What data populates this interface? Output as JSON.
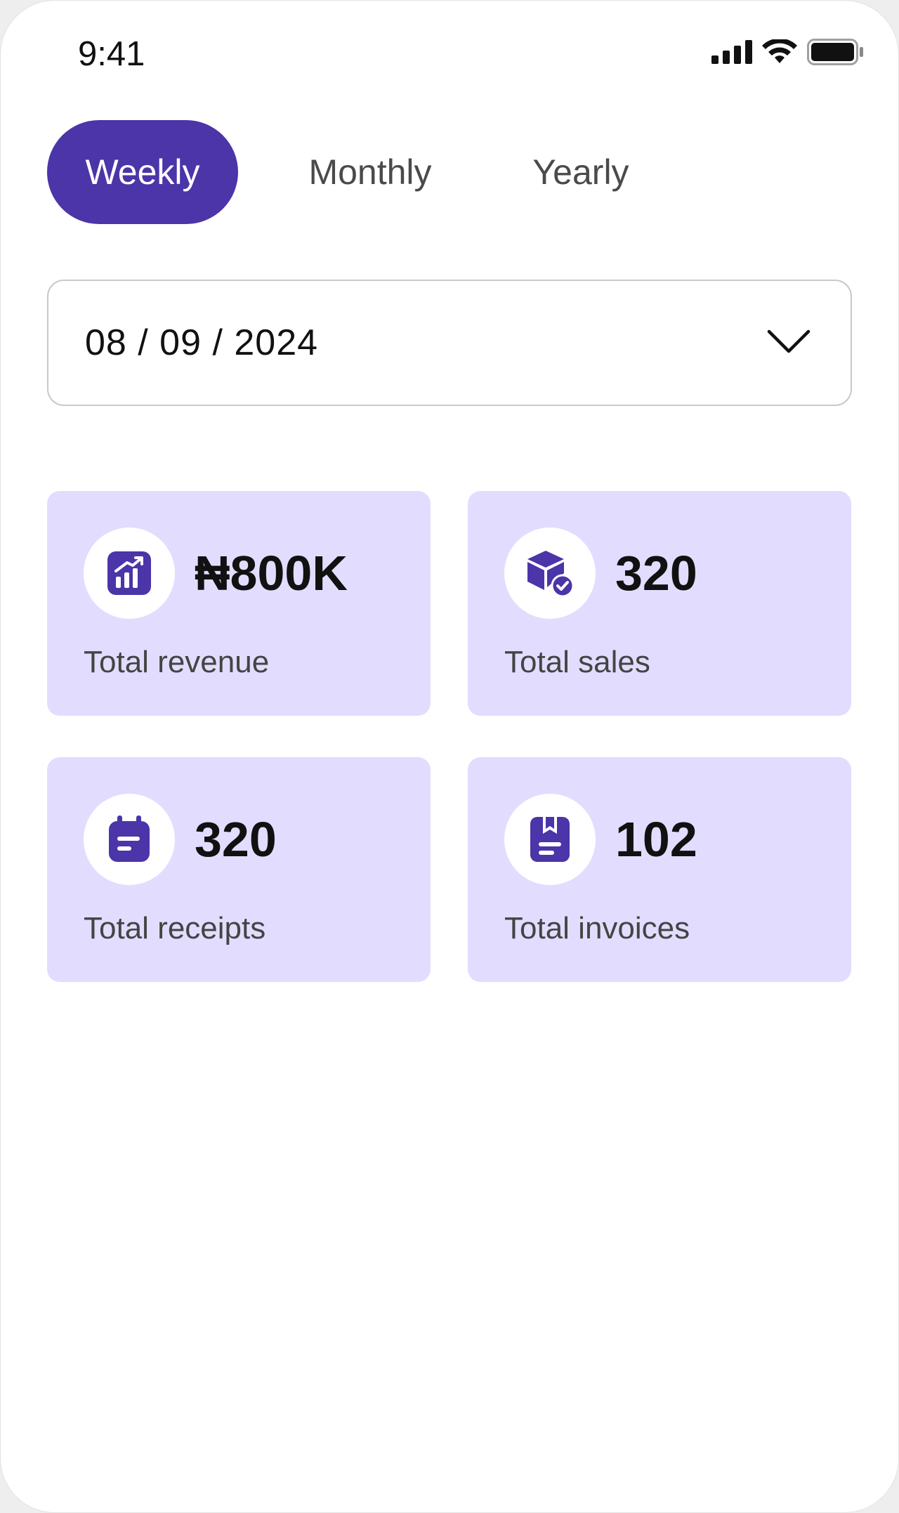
{
  "status_bar": {
    "time": "9:41",
    "icons": [
      "cellular-signal-icon",
      "wifi-icon",
      "battery-icon"
    ]
  },
  "period_tabs": {
    "selected": "Weekly",
    "items": [
      {
        "label": "Weekly",
        "active": true
      },
      {
        "label": "Monthly",
        "active": false
      },
      {
        "label": "Yearly",
        "active": false
      }
    ]
  },
  "date_select": {
    "value": "08 / 09 / 2024",
    "icon": "chevron-down-icon"
  },
  "stats": [
    {
      "value": "₦800K",
      "label": "Total revenue",
      "icon": "revenue-chart-icon"
    },
    {
      "value": "320",
      "label": "Total sales",
      "icon": "box-check-icon"
    },
    {
      "value": "320",
      "label": "Total receipts",
      "icon": "receipt-icon"
    },
    {
      "value": "102",
      "label": "Total invoices",
      "icon": "invoice-icon"
    }
  ],
  "colors": {
    "accent": "#4b35a8",
    "card_background": "#e2ddff",
    "text_primary": "#111111",
    "text_secondary": "#444444"
  }
}
